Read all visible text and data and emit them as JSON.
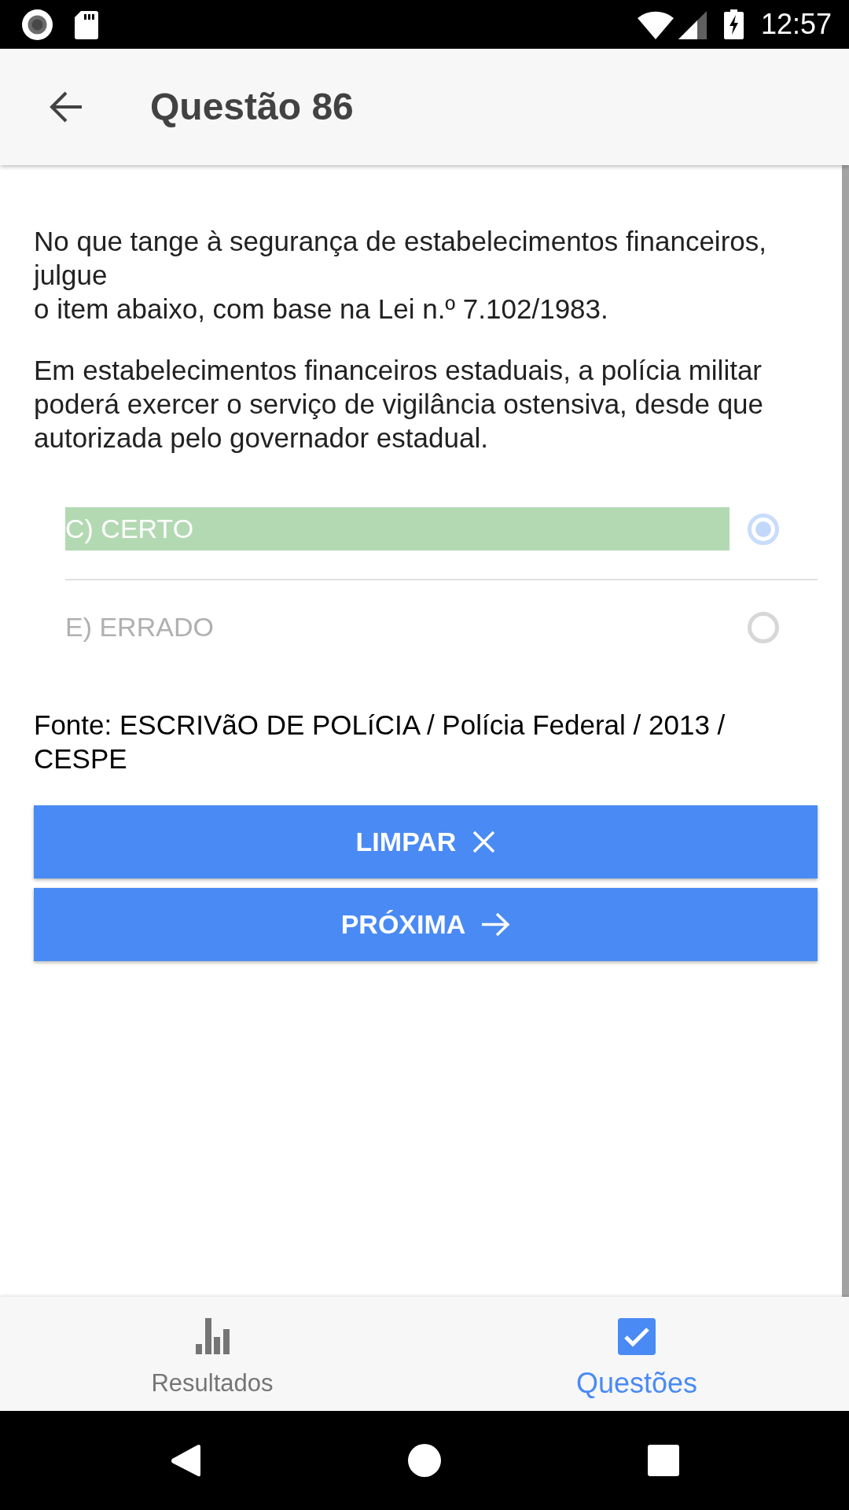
{
  "status_bar": {
    "time": "12:57"
  },
  "app_bar": {
    "title": "Questão 86"
  },
  "question": {
    "statement_lines": [
      "No que tange à segurança de estabelecimentos financeiros, julgue",
      "o item abaixo, com base na Lei n.º 7.102/1983."
    ],
    "item": "Em estabelecimentos financeiros estaduais, a polícia militar poderá exercer o serviço de vigilância ostensiva, desde que autorizada pelo governador estadual."
  },
  "options": [
    {
      "label": "C) CERTO",
      "selected": true,
      "correct": true,
      "disabled": true
    },
    {
      "label": "E) ERRADO",
      "selected": false,
      "correct": false,
      "disabled": true
    }
  ],
  "source": "Fonte: ESCRIVãO DE POLíCIA / Polícia Federal / 2013 / CESPE",
  "buttons": [
    {
      "kind": "clear",
      "label": "LIMPAR"
    },
    {
      "kind": "next",
      "label": "PRÓXIMA"
    }
  ],
  "bottom_nav": [
    {
      "kind": "results",
      "label": "Resultados",
      "selected": false
    },
    {
      "kind": "questions",
      "label": "Questões",
      "selected": true
    }
  ]
}
